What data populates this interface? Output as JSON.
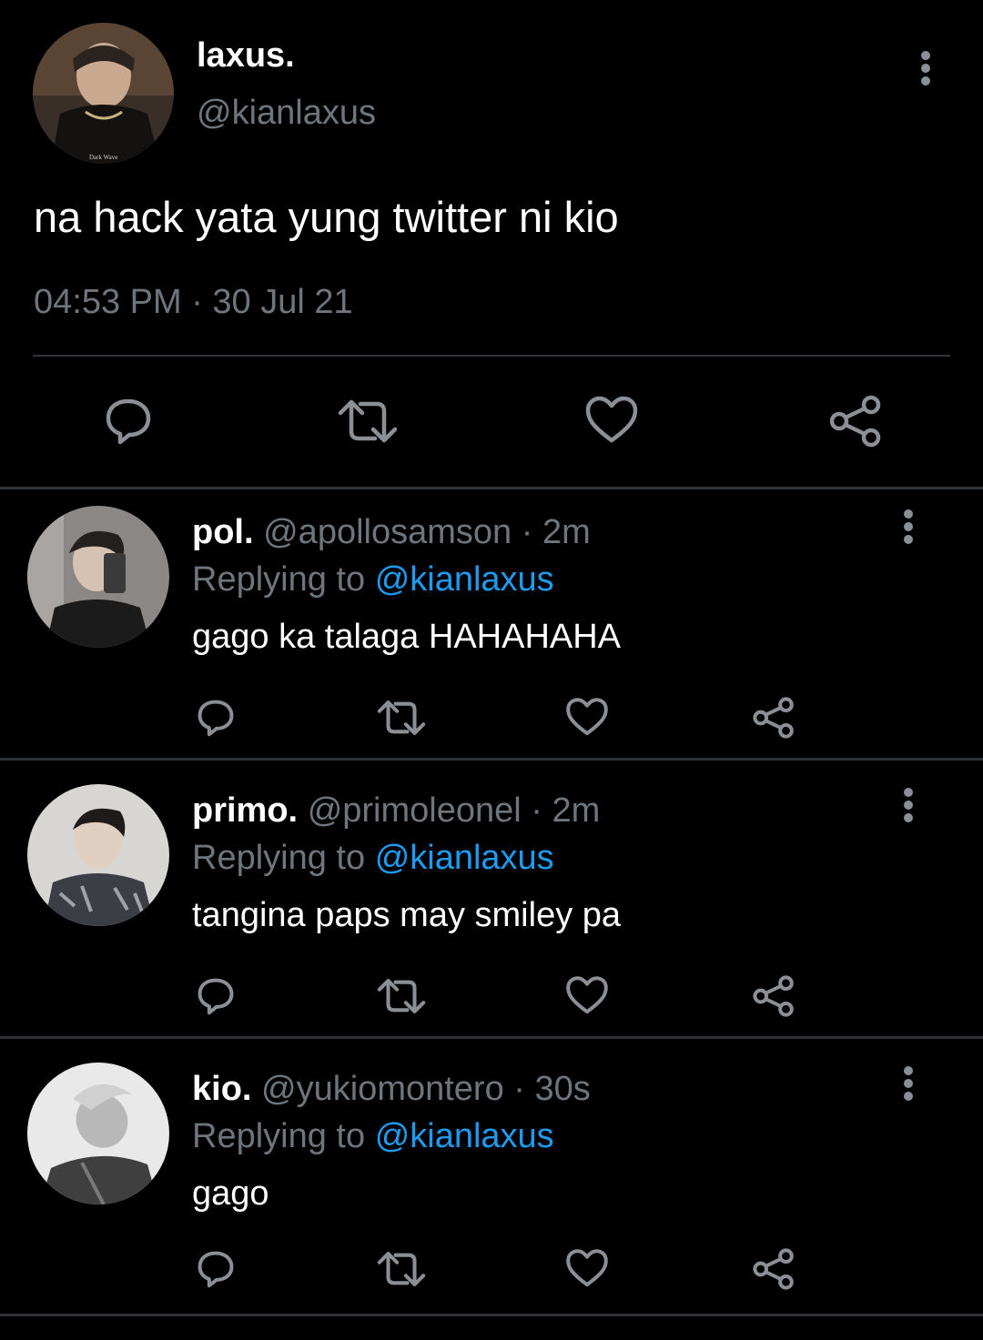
{
  "main_tweet": {
    "display_name": "laxus.",
    "handle": "@kianlaxus",
    "text": "na hack yata yung twitter ni kio",
    "timestamp": "04:53 PM · 30 Jul 21",
    "avatar_shirt_text": "Dark Wave",
    "actions": [
      "reply-icon",
      "retweet-icon",
      "like-icon",
      "share-icon"
    ]
  },
  "replies": [
    {
      "display_name": "pol.",
      "handle": "@apollosamson",
      "separator": "·",
      "time": "2m",
      "replying_label": "Replying to",
      "replying_to": "@kianlaxus",
      "text": "gago ka talaga HAHAHAHA"
    },
    {
      "display_name": "primo.",
      "handle": "@primoleonel",
      "separator": "·",
      "time": "2m",
      "replying_label": "Replying to",
      "replying_to": "@kianlaxus",
      "text": "tangina paps may smiley pa"
    },
    {
      "display_name": "kio.",
      "handle": "@yukiomontero",
      "separator": "·",
      "time": "30s",
      "replying_label": "Replying to",
      "replying_to": "@kianlaxus",
      "text": "gago"
    }
  ],
  "colors": {
    "background": "#000000",
    "text_primary": "#ffffff",
    "text_secondary": "#6e767d",
    "accent": "#1d9bf0",
    "divider": "#2f3336"
  }
}
